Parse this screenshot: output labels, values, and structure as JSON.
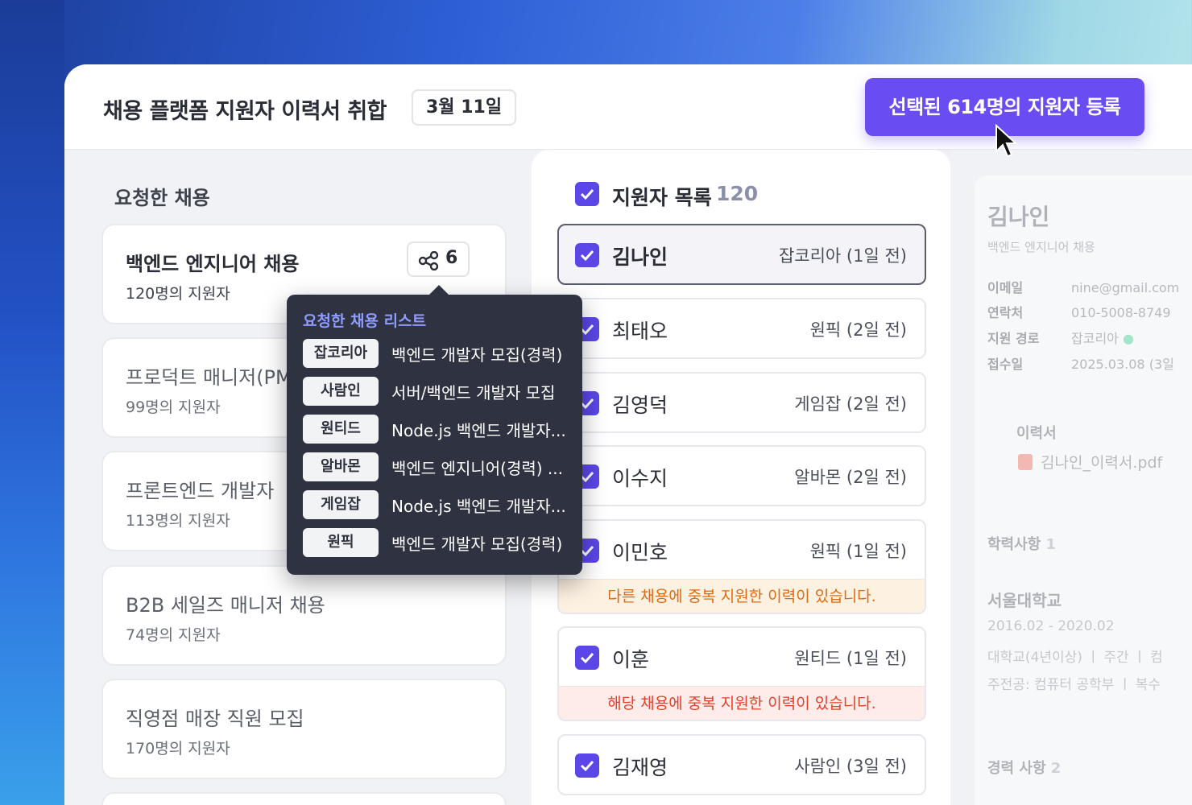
{
  "header": {
    "title": "채용 플랫폼 지원자 이력서 취합",
    "date": "3월 11일",
    "cta_label": "선택된 614명의 지원자 등록"
  },
  "requested": {
    "section_label": "요청한 채용",
    "jobs": [
      {
        "name": "백엔드 엔지니어 채용",
        "count": "120명의 지원자",
        "share_count": "6"
      },
      {
        "name": "프로덕트 매니저(PM",
        "count": "99명의 지원자"
      },
      {
        "name": "프론트엔드 개발자 ",
        "count": "113명의 지원자"
      },
      {
        "name": "B2B 세일즈 매니저 채용",
        "count": "74명의 지원자"
      },
      {
        "name": "직영점 매장 직원 모집",
        "count": "170명의 지원자"
      }
    ]
  },
  "popover": {
    "title": "요청한 채용 리스트",
    "items": [
      {
        "site": "잡코리아",
        "job": "백엔드 개발자 모집(경력)"
      },
      {
        "site": "사람인",
        "job": "서버/백엔드 개발자 모집"
      },
      {
        "site": "원티드",
        "job": "Node.js 백엔드 개발자..."
      },
      {
        "site": "알바몬",
        "job": "백엔드 엔지니어(경력) ..."
      },
      {
        "site": "게임잡",
        "job": "Node.js 백엔드 개발자..."
      },
      {
        "site": "원픽",
        "job": "백엔드 개발자 모집(경력)"
      }
    ]
  },
  "applicants": {
    "label": "지원자 목록",
    "count": "120",
    "items": [
      {
        "name": "김나인",
        "source": "잡코리아 (1일 전)",
        "selected": true
      },
      {
        "name": "최태오",
        "source": "원픽 (2일 전)"
      },
      {
        "name": "김영덕",
        "source": "게임잡 (2일 전)"
      },
      {
        "name": "이수지",
        "source": "알바몬 (2일 전)"
      },
      {
        "name": "이민호",
        "source": "원픽 (1일 전)",
        "warning": "다른 채용에 중복 지원한 이력이 있습니다."
      },
      {
        "name": "이훈",
        "source": "원티드 (1일 전)",
        "warning": "해당 채용에 중복 지원한 이력이 있습니다."
      },
      {
        "name": "김재영",
        "source": "사람인 (3일 전)"
      }
    ]
  },
  "detail": {
    "name": "김나인",
    "job": "백엔드 엔지니어 채용",
    "email_label": "이메일",
    "email": "nine@gmail.com",
    "phone_label": "연락처",
    "phone": "010-5008-8749",
    "route_label": "지원 경로",
    "route": "잡코리아",
    "date_label": "접수일",
    "date": "2025.03.08 (3일",
    "resume_label": "이력서",
    "resume_file": "김나인_이력서.pdf",
    "edu_label": "학력사항",
    "edu_count": "1",
    "school": "서울대학교",
    "school_period": "2016.02 - 2020.02",
    "school_type": "대학교(4년이상)  ㅣ 주간  ㅣ 컴",
    "major": "주전공: 컴퓨터 공학부  ㅣ 복수",
    "career_label": "경력 사항",
    "career_count": "2"
  },
  "colors": {
    "accent": "#6a4df2",
    "checkbox": "#5b47e8",
    "popover_bg": "#2f3240",
    "warn_orange": "#e06a12",
    "warn_red": "#e3402a"
  }
}
